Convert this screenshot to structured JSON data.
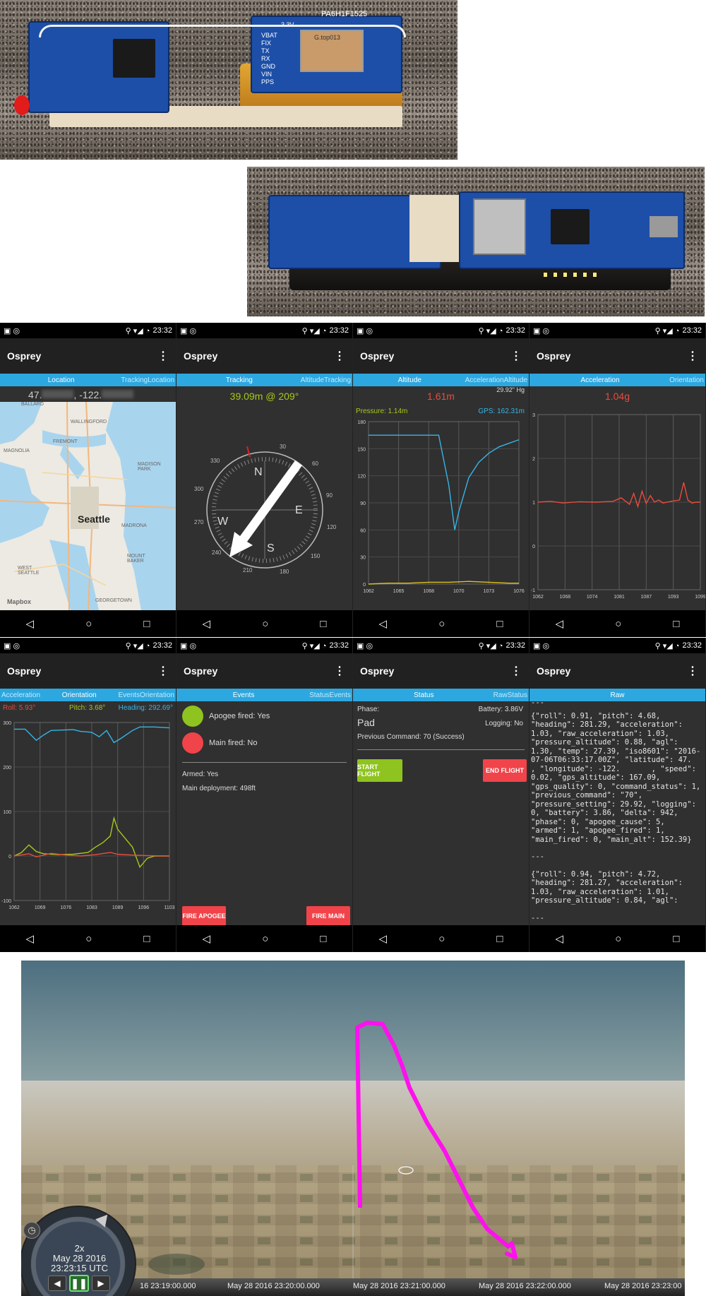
{
  "photos": {
    "photo1": {
      "gps_label": "PA6H1F1525",
      "gps_sub": "G.top013",
      "voltage": "3.3V",
      "pins": [
        "VBAT",
        "FIX",
        "TX",
        "RX",
        "GND",
        "VIN",
        "PPS"
      ]
    },
    "photo2": {}
  },
  "status_time": "23:32",
  "app_title": "Osprey",
  "screens": {
    "location": {
      "tabs": [
        "",
        "Location",
        "TrackingLocation"
      ],
      "active": 1,
      "lat": "47.",
      "lon": ", -122.",
      "map_labels": [
        "BALLARD",
        "WALLINGFORD",
        "FREMONT",
        "MAGNOLIA",
        "MADISON PARK",
        "Seattle",
        "MADRONA",
        "MOUNT BAKER",
        "WEST SEATTLE",
        "GEORGETOWN"
      ],
      "map_credit": "Mapbox"
    },
    "tracking": {
      "tabs": [
        "",
        "Tracking",
        "AltitudeTracking"
      ],
      "active": 1,
      "readout": "39.09m @ 209°",
      "compass": [
        "N",
        "E",
        "S",
        "W"
      ],
      "dial": [
        "30",
        "60",
        "90",
        "120",
        "150",
        "180",
        "210",
        "240",
        "270",
        "300",
        "330"
      ]
    },
    "altitude": {
      "tabs": [
        "",
        "Altitude",
        "AccelerationAltitude"
      ],
      "active": 1,
      "readout": "1.61m",
      "pressure_setting": "29.92\" Hg",
      "pressure_label": "Pressure: 1.14m",
      "gps_label": "GPS: 162.31m"
    },
    "acceleration": {
      "tabs": [
        "",
        "Acceleration",
        "Orientation"
      ],
      "active": 1,
      "readout": "1.04g"
    },
    "orientation": {
      "tabs": [
        "Acceleration",
        "Orientation",
        "EventsOrientation"
      ],
      "active": 1,
      "roll": "Roll: 5.93°",
      "pitch": "Pitch: 3.68°",
      "heading": "Heading: 292.69°"
    },
    "events": {
      "tabs": [
        "",
        "Events",
        "StatusEvents"
      ],
      "active": 1,
      "apogee": "Apogee fired: Yes",
      "main": "Main fired: No",
      "armed": "Armed: Yes",
      "deployment": "Main deployment: 498ft",
      "fire_apogee": "FIRE APOGEE",
      "fire_main": "FIRE MAIN"
    },
    "status": {
      "tabs": [
        "",
        "Status",
        "RawStatus"
      ],
      "active": 1,
      "phase_label": "Phase:",
      "phase": "Pad",
      "battery": "Battery: 3.86V",
      "logging": "Logging: No",
      "prev_cmd": "Previous Command: 70 (Success)",
      "start": "START FLIGHT",
      "end": "END FLIGHT"
    },
    "raw": {
      "tabs": [
        "",
        "Raw",
        ""
      ],
      "active": 1,
      "top_sep": "---",
      "json1": "{\"roll\": 0.91, \"pitch\": 4.68, \"heading\": 281.29, \"acceleration\": 1.03, \"raw_acceleration\": 1.03, \"pressure_altitude\": 0.88, \"agl\": 1.30, \"temp\": 27.39, \"iso8601\": \"2016-07-06T06:33:17.00Z\", \"latitude\": 47.      , \"longitude\": -122.       , \"speed\": 0.02, \"gps_altitude\": 167.09, \"gps_quality\": 0, \"command_status\": 1, \"previous_command\": \"70\", \"pressure_setting\": 29.92, \"logging\": 0, \"battery\": 3.86, \"delta\": 942, \"phase\": 0, \"apogee_cause\": 5, \"armed\": 1, \"apogee_fired\": 1, \"main_fired\": 0, \"main_alt\": 152.39}",
      "sep": "---",
      "json2": "{\"roll\": 0.94, \"pitch\": 4.72, \"heading\": 281.27, \"acceleration\": 1.03, \"raw_acceleration\": 1.01, \"pressure_altitude\": 0.84, \"agl\":",
      "sep2": "---"
    }
  },
  "chart_data": [
    {
      "type": "line",
      "title": "Altitude",
      "ylim": [
        0,
        180
      ],
      "yticks": [
        "0",
        "30",
        "60",
        "90",
        "120",
        "150",
        "180"
      ],
      "xticks": [
        "1062",
        "1065",
        "1068",
        "1070",
        "1073",
        "1076"
      ],
      "series": [
        {
          "name": "GPS",
          "color": "#37b4e6",
          "x": [
            1062,
            1064,
            1066,
            1068,
            1069,
            1070,
            1070.6,
            1071,
            1072,
            1073,
            1074,
            1075,
            1076,
            1077
          ],
          "values": [
            165,
            165,
            165,
            165,
            165,
            110,
            60,
            80,
            118,
            135,
            145,
            152,
            156,
            160
          ]
        },
        {
          "name": "Pressure",
          "color": "#e0c020",
          "x": [
            1062,
            1064,
            1066,
            1068,
            1070,
            1072,
            1074,
            1076,
            1077
          ],
          "values": [
            0,
            1,
            1,
            2,
            2,
            3,
            2,
            1,
            1
          ]
        }
      ]
    },
    {
      "type": "line",
      "title": "Acceleration",
      "ylim": [
        -1,
        3
      ],
      "yticks": [
        "-1",
        "0",
        "1",
        "2",
        "3"
      ],
      "xticks": [
        "1062",
        "1068",
        "1074",
        "1081",
        "1087",
        "1093",
        "1099"
      ],
      "series": [
        {
          "name": "",
          "color": "#e84c3d",
          "x": [
            1062,
            1065,
            1068,
            1072,
            1076,
            1080,
            1082,
            1084,
            1085,
            1086,
            1087,
            1088,
            1089,
            1090,
            1091,
            1092,
            1094,
            1096,
            1097,
            1098,
            1099,
            1100,
            1101
          ],
          "values": [
            1.0,
            1.02,
            0.98,
            1.01,
            1.0,
            1.02,
            1.1,
            0.95,
            1.2,
            0.9,
            1.25,
            0.97,
            1.15,
            1.0,
            1.05,
            0.98,
            1.02,
            1.05,
            1.45,
            1.05,
            0.98,
            1.0,
            1.0
          ]
        }
      ]
    },
    {
      "type": "line",
      "title": "Orientation",
      "ylim": [
        -100,
        300
      ],
      "yticks": [
        "-100",
        "0",
        "100",
        "200",
        "300"
      ],
      "xticks": [
        "1062",
        "1069",
        "1076",
        "1083",
        "1089",
        "1096",
        "1103"
      ],
      "series": [
        {
          "name": "Heading",
          "color": "#37b4e6",
          "x": [
            1062,
            1065,
            1068,
            1070,
            1072,
            1075,
            1078,
            1080,
            1083,
            1085,
            1087,
            1089,
            1091,
            1094,
            1096,
            1100,
            1104
          ],
          "values": [
            285,
            285,
            260,
            272,
            282,
            283,
            284,
            280,
            278,
            268,
            282,
            255,
            265,
            282,
            290,
            290,
            288
          ]
        },
        {
          "name": "Pitch",
          "color": "#a6c81a",
          "x": [
            1062,
            1064,
            1066,
            1068,
            1070,
            1074,
            1078,
            1082,
            1084,
            1086,
            1088,
            1089,
            1090,
            1092,
            1094,
            1096,
            1098,
            1100,
            1104
          ],
          "values": [
            0,
            8,
            25,
            10,
            5,
            3,
            4,
            8,
            20,
            30,
            45,
            85,
            60,
            40,
            20,
            -25,
            -5,
            0,
            0
          ]
        },
        {
          "name": "Roll",
          "color": "#e84c3d",
          "x": [
            1062,
            1066,
            1068,
            1072,
            1076,
            1080,
            1084,
            1088,
            1090,
            1094,
            1098,
            1104
          ],
          "values": [
            0,
            5,
            -2,
            6,
            2,
            0,
            3,
            8,
            4,
            2,
            1,
            0
          ]
        }
      ]
    }
  ],
  "cesium": {
    "speed": "2x",
    "date": "May 28 2016",
    "time": "23:23:15 UTC",
    "ticks": [
      "16 23:19:00.000",
      "May 28 2016 23:20:00.000",
      "May 28 2016 23:21:00.000",
      "May 28 2016 23:22:00.000",
      "May 28 2016 23:23:00"
    ],
    "track_color": "#ff10ee"
  }
}
